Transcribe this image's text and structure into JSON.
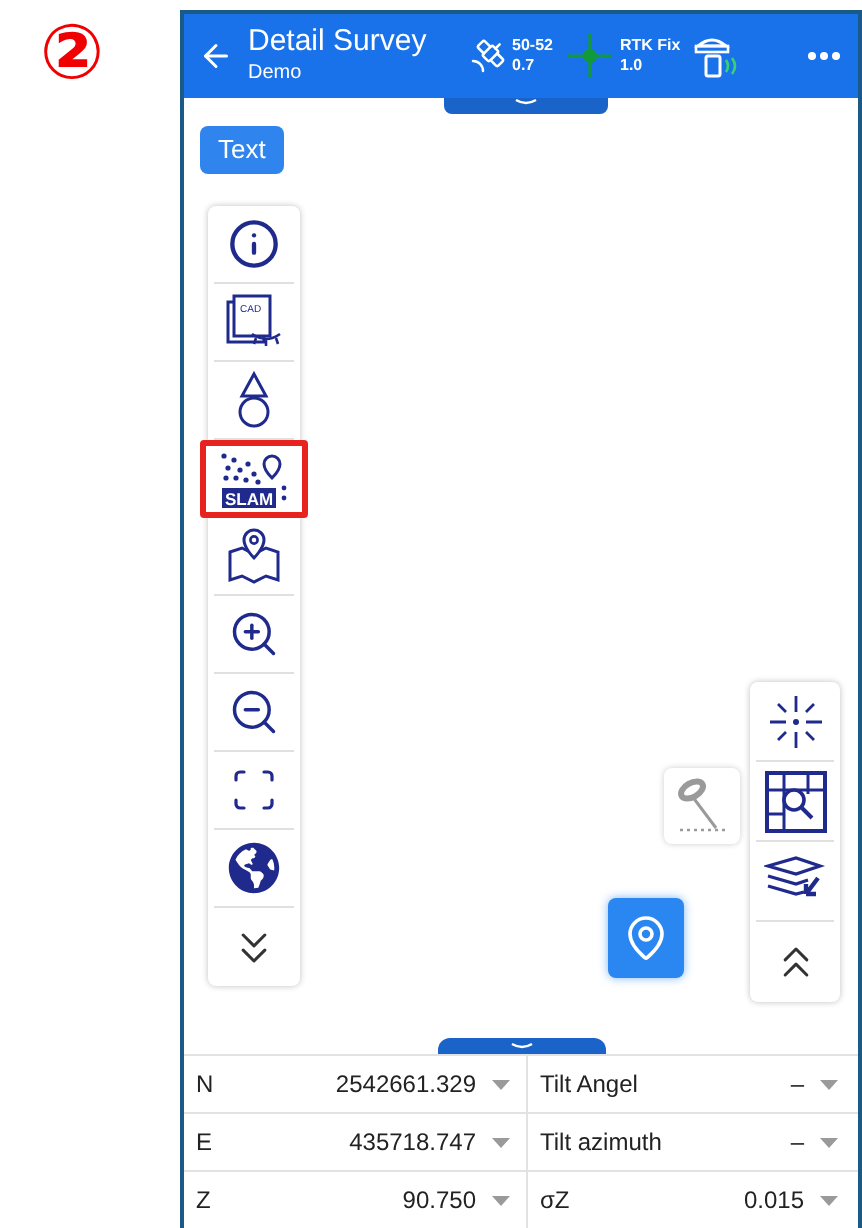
{
  "step_marker": "②",
  "header": {
    "title": "Detail Survey",
    "subtitle": "Demo",
    "satellites": {
      "count": "50-52",
      "value": "0.7"
    },
    "solution": {
      "status": "RTK Fix",
      "value": "1.0"
    }
  },
  "text_button": "Text",
  "left_toolbar": [
    {
      "kind": "info",
      "highlighted": false
    },
    {
      "kind": "cad",
      "label": "CAD",
      "highlighted": false
    },
    {
      "kind": "stakeout",
      "highlighted": false
    },
    {
      "kind": "slam",
      "label": "SLAM",
      "highlighted": true
    },
    {
      "kind": "map",
      "highlighted": false
    },
    {
      "kind": "zoom_in",
      "highlighted": false
    },
    {
      "kind": "zoom_out",
      "highlighted": false
    },
    {
      "kind": "fit",
      "highlighted": false
    },
    {
      "kind": "globe",
      "highlighted": false
    },
    {
      "kind": "expand",
      "highlighted": false
    }
  ],
  "right_toolbar": [
    {
      "kind": "center"
    },
    {
      "kind": "search_grid"
    },
    {
      "kind": "layers"
    },
    {
      "kind": "collapse"
    }
  ],
  "readings": [
    {
      "label": "N",
      "value": "2542661.329",
      "label_2": "Tilt Angel",
      "value_2": "–"
    },
    {
      "label": "E",
      "value": "435718.747",
      "label_2": "Tilt azimuth",
      "value_2": "–"
    },
    {
      "label": "Z",
      "value": "90.750",
      "label_2": "σZ",
      "value_2": "0.015"
    }
  ]
}
